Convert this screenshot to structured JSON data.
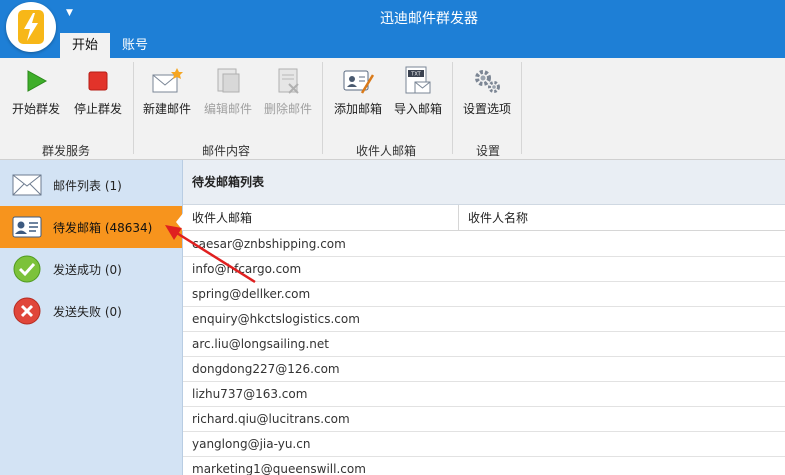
{
  "app": {
    "title": "迅迪邮件群发器",
    "accent": "#1e7fd6"
  },
  "tabs": [
    {
      "label": "开始",
      "active": true
    },
    {
      "label": "账号",
      "active": false
    }
  ],
  "ribbon": {
    "buttons": {
      "start": {
        "label": "开始群发",
        "icon": "play-icon"
      },
      "stop": {
        "label": "停止群发",
        "icon": "stop-icon"
      },
      "new_mail": {
        "label": "新建邮件",
        "icon": "new-mail-icon"
      },
      "edit_mail": {
        "label": "编辑邮件",
        "icon": "edit-mail-icon",
        "disabled": true
      },
      "delete_mail": {
        "label": "删除邮件",
        "icon": "delete-mail-icon",
        "disabled": true
      },
      "add_mailbox": {
        "label": "添加邮箱",
        "icon": "add-contact-icon"
      },
      "import_mailbox": {
        "label": "导入邮箱",
        "icon": "import-txt-icon"
      },
      "settings": {
        "label": "设置选项",
        "icon": "gears-icon"
      }
    },
    "groups": {
      "send_service": "群发服务",
      "mail_content": "邮件内容",
      "recipient_mailbox": "收件人邮箱",
      "settings": "设置"
    }
  },
  "sidebar": {
    "items": [
      {
        "label": "邮件列表 (1)",
        "icon": "envelope-icon",
        "active": false
      },
      {
        "label": "待发邮箱 (48634)",
        "icon": "contact-card-icon",
        "active": true
      },
      {
        "label": "发送成功 (0)",
        "icon": "check-circle-icon",
        "active": false
      },
      {
        "label": "发送失败 (0)",
        "icon": "error-circle-icon",
        "active": false
      }
    ]
  },
  "main": {
    "header": "待发邮箱列表",
    "columns": [
      "收件人邮箱",
      "收件人名称"
    ],
    "rows": [
      "caesar@znbshipping.com",
      "info@hfcargo.com",
      "spring@dellker.com",
      "enquiry@hkctslogistics.com",
      "arc.liu@longsailing.net",
      "dongdong227@126.com",
      "lizhu737@163.com",
      "richard.qiu@lucitrans.com",
      "yanglong@jia-yu.cn",
      "marketing1@queenswill.com"
    ]
  }
}
